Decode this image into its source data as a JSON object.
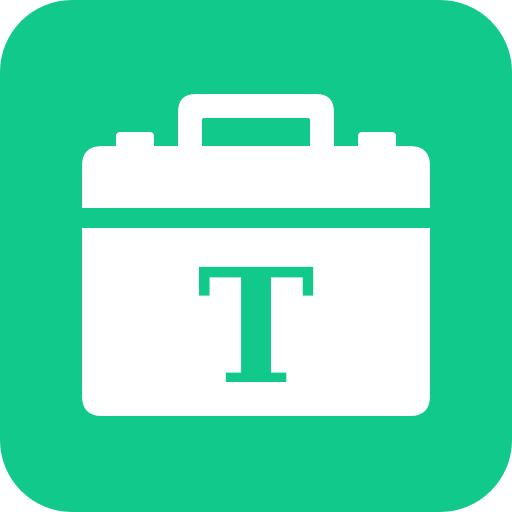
{
  "icon": {
    "name": "toolbox-text-app-icon",
    "semantic": "toolbox-icon",
    "letter": "T",
    "colors": {
      "background": "#10C98A",
      "foreground": "#FFFFFF",
      "letter": "#10C98A"
    }
  }
}
